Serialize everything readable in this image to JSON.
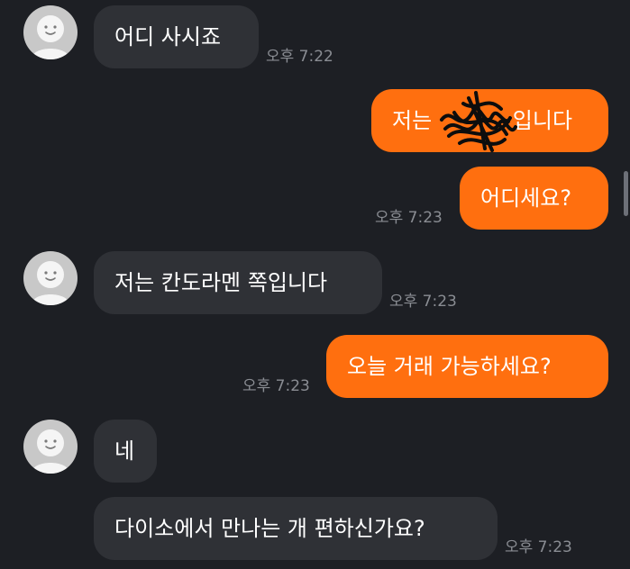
{
  "messages": [
    {
      "sender": "other",
      "text": "어디 사시죠",
      "time": "오후 7:22"
    },
    {
      "sender": "me",
      "text": "저는 ",
      "redacted": true,
      "text_after": "입니다"
    },
    {
      "sender": "me",
      "text": "어디세요?",
      "time": "오후 7:23"
    },
    {
      "sender": "other",
      "text": "저는 칸도라멘 쪽입니다",
      "time": "오후 7:23"
    },
    {
      "sender": "me",
      "text": "오늘 거래 가능하세요?",
      "time": "오후 7:23"
    },
    {
      "sender": "other",
      "text": "네"
    },
    {
      "sender": "other",
      "text": "다이소에서 만나는 개 편하신가요?",
      "time": "오후 7:23"
    }
  ],
  "colors": {
    "background": "#1d1f24",
    "incoming_bubble": "#2f3136",
    "outgoing_bubble": "#ff6f0f",
    "timestamp": "#8a8d93",
    "message_text": "#ffffff",
    "avatar": "#c8c8c8"
  },
  "icons": {
    "avatar": "default-profile-face-icon"
  }
}
